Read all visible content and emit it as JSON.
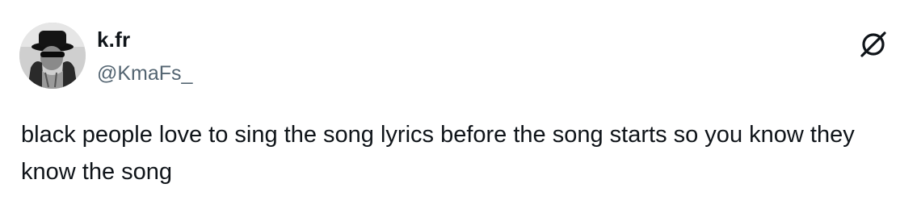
{
  "author": {
    "display_name": "k.fr",
    "handle": "@KmaFs_",
    "avatar_icon": "profile-photo"
  },
  "actions": {
    "grok_icon": "grok-icon"
  },
  "tweet": {
    "text": "black people love to sing the song lyrics before the song starts so you know they know the song"
  },
  "colors": {
    "text_primary": "#0f1419",
    "text_secondary": "#536471",
    "background": "#ffffff"
  }
}
